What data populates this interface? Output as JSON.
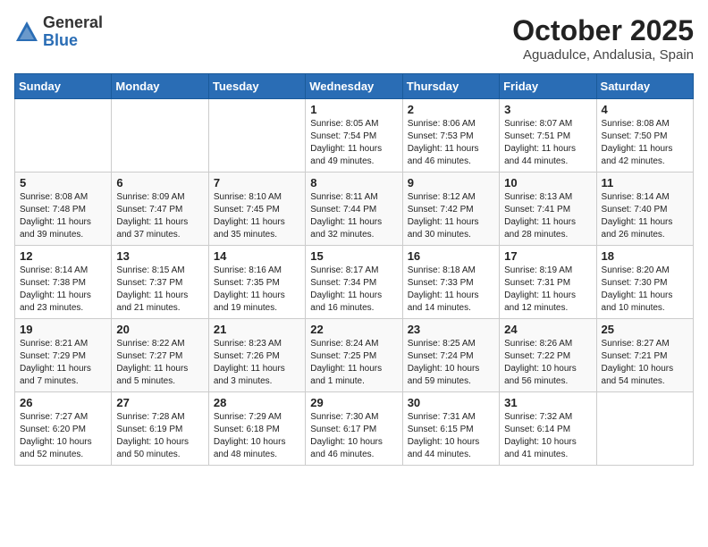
{
  "header": {
    "logo_general": "General",
    "logo_blue": "Blue",
    "month": "October 2025",
    "location": "Aguadulce, Andalusia, Spain"
  },
  "weekdays": [
    "Sunday",
    "Monday",
    "Tuesday",
    "Wednesday",
    "Thursday",
    "Friday",
    "Saturday"
  ],
  "weeks": [
    [
      {
        "day": "",
        "info": ""
      },
      {
        "day": "",
        "info": ""
      },
      {
        "day": "",
        "info": ""
      },
      {
        "day": "1",
        "info": "Sunrise: 8:05 AM\nSunset: 7:54 PM\nDaylight: 11 hours and 49 minutes."
      },
      {
        "day": "2",
        "info": "Sunrise: 8:06 AM\nSunset: 7:53 PM\nDaylight: 11 hours and 46 minutes."
      },
      {
        "day": "3",
        "info": "Sunrise: 8:07 AM\nSunset: 7:51 PM\nDaylight: 11 hours and 44 minutes."
      },
      {
        "day": "4",
        "info": "Sunrise: 8:08 AM\nSunset: 7:50 PM\nDaylight: 11 hours and 42 minutes."
      }
    ],
    [
      {
        "day": "5",
        "info": "Sunrise: 8:08 AM\nSunset: 7:48 PM\nDaylight: 11 hours and 39 minutes."
      },
      {
        "day": "6",
        "info": "Sunrise: 8:09 AM\nSunset: 7:47 PM\nDaylight: 11 hours and 37 minutes."
      },
      {
        "day": "7",
        "info": "Sunrise: 8:10 AM\nSunset: 7:45 PM\nDaylight: 11 hours and 35 minutes."
      },
      {
        "day": "8",
        "info": "Sunrise: 8:11 AM\nSunset: 7:44 PM\nDaylight: 11 hours and 32 minutes."
      },
      {
        "day": "9",
        "info": "Sunrise: 8:12 AM\nSunset: 7:42 PM\nDaylight: 11 hours and 30 minutes."
      },
      {
        "day": "10",
        "info": "Sunrise: 8:13 AM\nSunset: 7:41 PM\nDaylight: 11 hours and 28 minutes."
      },
      {
        "day": "11",
        "info": "Sunrise: 8:14 AM\nSunset: 7:40 PM\nDaylight: 11 hours and 26 minutes."
      }
    ],
    [
      {
        "day": "12",
        "info": "Sunrise: 8:14 AM\nSunset: 7:38 PM\nDaylight: 11 hours and 23 minutes."
      },
      {
        "day": "13",
        "info": "Sunrise: 8:15 AM\nSunset: 7:37 PM\nDaylight: 11 hours and 21 minutes."
      },
      {
        "day": "14",
        "info": "Sunrise: 8:16 AM\nSunset: 7:35 PM\nDaylight: 11 hours and 19 minutes."
      },
      {
        "day": "15",
        "info": "Sunrise: 8:17 AM\nSunset: 7:34 PM\nDaylight: 11 hours and 16 minutes."
      },
      {
        "day": "16",
        "info": "Sunrise: 8:18 AM\nSunset: 7:33 PM\nDaylight: 11 hours and 14 minutes."
      },
      {
        "day": "17",
        "info": "Sunrise: 8:19 AM\nSunset: 7:31 PM\nDaylight: 11 hours and 12 minutes."
      },
      {
        "day": "18",
        "info": "Sunrise: 8:20 AM\nSunset: 7:30 PM\nDaylight: 11 hours and 10 minutes."
      }
    ],
    [
      {
        "day": "19",
        "info": "Sunrise: 8:21 AM\nSunset: 7:29 PM\nDaylight: 11 hours and 7 minutes."
      },
      {
        "day": "20",
        "info": "Sunrise: 8:22 AM\nSunset: 7:27 PM\nDaylight: 11 hours and 5 minutes."
      },
      {
        "day": "21",
        "info": "Sunrise: 8:23 AM\nSunset: 7:26 PM\nDaylight: 11 hours and 3 minutes."
      },
      {
        "day": "22",
        "info": "Sunrise: 8:24 AM\nSunset: 7:25 PM\nDaylight: 11 hours and 1 minute."
      },
      {
        "day": "23",
        "info": "Sunrise: 8:25 AM\nSunset: 7:24 PM\nDaylight: 10 hours and 59 minutes."
      },
      {
        "day": "24",
        "info": "Sunrise: 8:26 AM\nSunset: 7:22 PM\nDaylight: 10 hours and 56 minutes."
      },
      {
        "day": "25",
        "info": "Sunrise: 8:27 AM\nSunset: 7:21 PM\nDaylight: 10 hours and 54 minutes."
      }
    ],
    [
      {
        "day": "26",
        "info": "Sunrise: 7:27 AM\nSunset: 6:20 PM\nDaylight: 10 hours and 52 minutes."
      },
      {
        "day": "27",
        "info": "Sunrise: 7:28 AM\nSunset: 6:19 PM\nDaylight: 10 hours and 50 minutes."
      },
      {
        "day": "28",
        "info": "Sunrise: 7:29 AM\nSunset: 6:18 PM\nDaylight: 10 hours and 48 minutes."
      },
      {
        "day": "29",
        "info": "Sunrise: 7:30 AM\nSunset: 6:17 PM\nDaylight: 10 hours and 46 minutes."
      },
      {
        "day": "30",
        "info": "Sunrise: 7:31 AM\nSunset: 6:15 PM\nDaylight: 10 hours and 44 minutes."
      },
      {
        "day": "31",
        "info": "Sunrise: 7:32 AM\nSunset: 6:14 PM\nDaylight: 10 hours and 41 minutes."
      },
      {
        "day": "",
        "info": ""
      }
    ]
  ]
}
